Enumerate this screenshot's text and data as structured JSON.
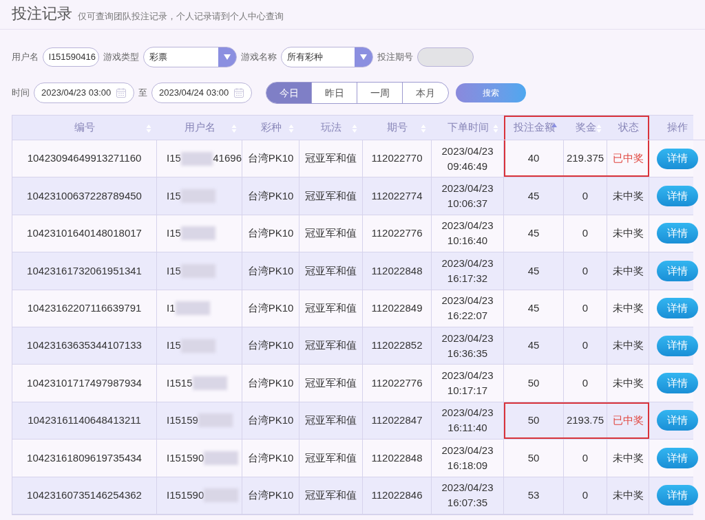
{
  "page": {
    "title": "投注记录",
    "subtitle": "仅可查询团队投注记录，个人记录请到个人中心查询"
  },
  "filters": {
    "username": {
      "label": "用户名",
      "value": "l151590416"
    },
    "game_type": {
      "label": "游戏类型",
      "value": "彩票"
    },
    "game_name": {
      "label": "游戏名称",
      "value": "所有彩种"
    },
    "period": {
      "label": "投注期号",
      "disabled": true
    },
    "time": {
      "label": "时间",
      "from": "2023/04/23 03:00",
      "separator": "至",
      "to": "2023/04/24 03:00"
    },
    "ranges": [
      {
        "label": "今日",
        "selected": true
      },
      {
        "label": "昨日",
        "selected": false
      },
      {
        "label": "一周",
        "selected": false
      },
      {
        "label": "本月",
        "selected": false
      }
    ],
    "search_button": "搜索"
  },
  "table": {
    "columns": [
      {
        "label": "编号",
        "sortable": true,
        "sorted": false,
        "highlighted": false
      },
      {
        "label": "用户名",
        "sortable": true,
        "sorted": false,
        "highlighted": false
      },
      {
        "label": "彩种",
        "sortable": true,
        "sorted": false,
        "highlighted": false
      },
      {
        "label": "玩法",
        "sortable": true,
        "sorted": false,
        "highlighted": false
      },
      {
        "label": "期号",
        "sortable": true,
        "sorted": false,
        "highlighted": false
      },
      {
        "label": "下单时间",
        "sortable": true,
        "sorted": false,
        "highlighted": false
      },
      {
        "label": "投注金额",
        "sortable": true,
        "sorted": true,
        "highlighted": true
      },
      {
        "label": "奖金",
        "sortable": true,
        "sorted": false,
        "highlighted": true
      },
      {
        "label": "状态",
        "sortable": false,
        "highlighted": true
      },
      {
        "label": "操作",
        "sortable": false,
        "highlighted": false
      }
    ],
    "rows": [
      {
        "id": "10423094649913271160",
        "user_prefix": "I15",
        "user_suffix": "41696",
        "lottery": "台湾PK10",
        "play": "冠亚军和值",
        "period": "112022770",
        "date": "2023/04/23",
        "time": "09:46:49",
        "amount": "40",
        "prize": "219.375",
        "status": "已中奖",
        "won": true,
        "highlighted": true,
        "action": "详情"
      },
      {
        "id": "10423100637228789450",
        "user_prefix": "I15",
        "lottery": "台湾PK10",
        "play": "冠亚军和值",
        "period": "112022774",
        "date": "2023/04/23",
        "time": "10:06:37",
        "amount": "45",
        "prize": "0",
        "status": "未中奖",
        "won": false,
        "highlighted": false,
        "action": "详情"
      },
      {
        "id": "10423101640148018017",
        "user_prefix": "I15",
        "lottery": "台湾PK10",
        "play": "冠亚军和值",
        "period": "112022776",
        "date": "2023/04/23",
        "time": "10:16:40",
        "amount": "45",
        "prize": "0",
        "status": "未中奖",
        "won": false,
        "highlighted": false,
        "action": "详情"
      },
      {
        "id": "10423161732061951341",
        "user_prefix": "I15",
        "lottery": "台湾PK10",
        "play": "冠亚军和值",
        "period": "112022848",
        "date": "2023/04/23",
        "time": "16:17:32",
        "amount": "45",
        "prize": "0",
        "status": "未中奖",
        "won": false,
        "highlighted": false,
        "action": "详情"
      },
      {
        "id": "10423162207116639791",
        "user_prefix": "I1",
        "lottery": "台湾PK10",
        "play": "冠亚军和值",
        "period": "112022849",
        "date": "2023/04/23",
        "time": "16:22:07",
        "amount": "45",
        "prize": "0",
        "status": "未中奖",
        "won": false,
        "highlighted": false,
        "action": "详情"
      },
      {
        "id": "10423163635344107133",
        "user_prefix": "I15",
        "lottery": "台湾PK10",
        "play": "冠亚军和值",
        "period": "112022852",
        "date": "2023/04/23",
        "time": "16:36:35",
        "amount": "45",
        "prize": "0",
        "status": "未中奖",
        "won": false,
        "highlighted": false,
        "action": "详情"
      },
      {
        "id": "10423101717497987934",
        "user_prefix": "I1515",
        "lottery": "台湾PK10",
        "play": "冠亚军和值",
        "period": "112022776",
        "date": "2023/04/23",
        "time": "10:17:17",
        "amount": "50",
        "prize": "0",
        "status": "未中奖",
        "won": false,
        "highlighted": false,
        "action": "详情"
      },
      {
        "id": "10423161140648413211",
        "user_prefix": "I15159",
        "lottery": "台湾PK10",
        "play": "冠亚军和值",
        "period": "112022847",
        "date": "2023/04/23",
        "time": "16:11:40",
        "amount": "50",
        "prize": "2193.75",
        "status": "已中奖",
        "won": true,
        "highlighted": true,
        "action": "详情"
      },
      {
        "id": "10423161809619735434",
        "user_prefix": "I151590",
        "lottery": "台湾PK10",
        "play": "冠亚军和值",
        "period": "112022848",
        "date": "2023/04/23",
        "time": "16:18:09",
        "amount": "50",
        "prize": "0",
        "status": "未中奖",
        "won": false,
        "highlighted": false,
        "action": "详情"
      },
      {
        "id": "10423160735146254362",
        "user_prefix": "I151590",
        "lottery": "台湾PK10",
        "play": "冠亚军和值",
        "period": "112022846",
        "date": "2023/04/23",
        "time": "16:07:35",
        "amount": "53",
        "prize": "0",
        "status": "未中奖",
        "won": false,
        "highlighted": false,
        "action": "详情"
      }
    ]
  }
}
